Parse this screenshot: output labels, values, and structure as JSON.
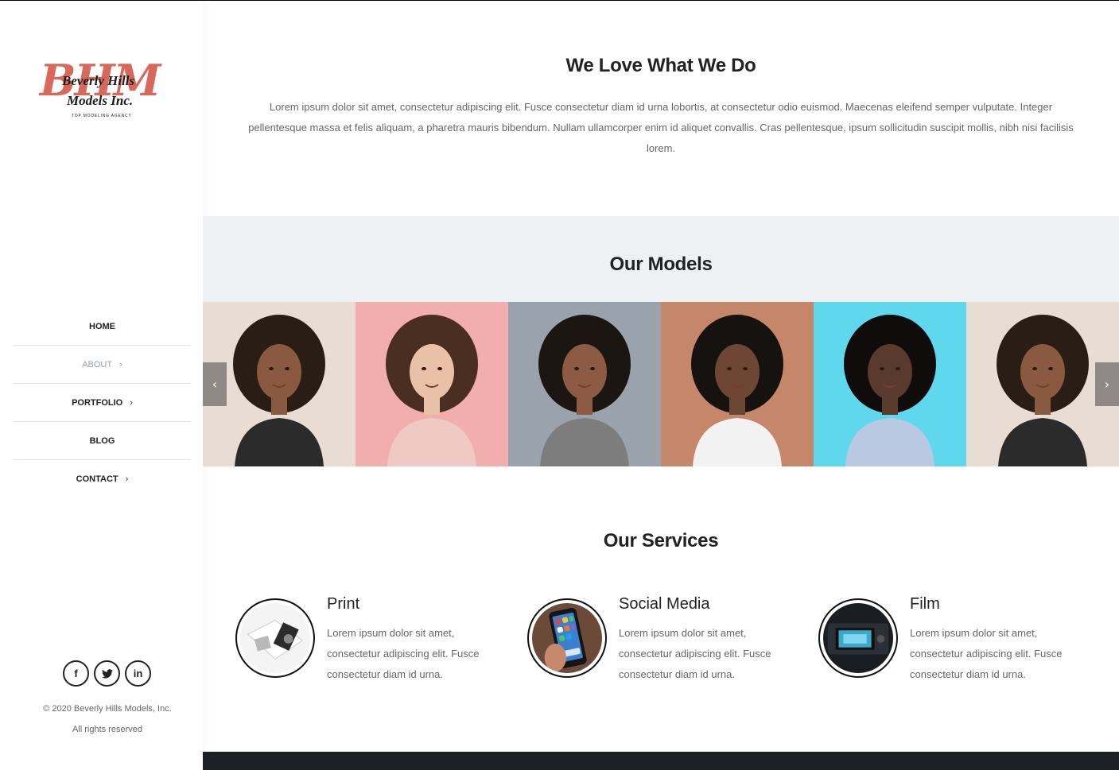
{
  "brand": {
    "logo_big": "BHM",
    "logo_line1": "Beverly Hills",
    "logo_line2": "Models Inc.",
    "tagline": "TOP MODELING AGENCY",
    "accent_color": "#d8695a"
  },
  "nav": {
    "items": [
      {
        "label": "HOME",
        "has_submenu": false,
        "active": false
      },
      {
        "label": "ABOUT",
        "has_submenu": true,
        "active": true
      },
      {
        "label": "PORTFOLIO",
        "has_submenu": true,
        "active": false
      },
      {
        "label": "BLOG",
        "has_submenu": false,
        "active": false
      },
      {
        "label": "CONTACT",
        "has_submenu": true,
        "active": false
      }
    ],
    "chevron": "›"
  },
  "social": {
    "facebook": "f",
    "twitter": "t",
    "linkedin": "in"
  },
  "footer": {
    "copyright": "© 2020 Beverly Hills Models, Inc.",
    "rights": "All rights reserved"
  },
  "intro": {
    "title": "We Love What We Do",
    "body": "Lorem ipsum dolor sit amet, consectetur adipiscing elit. Fusce consectetur diam id urna lobortis, at consectetur odio euismod. Maecenas eleifend semper vulputate. Integer pellentesque massa et felis aliquam, a pharetra mauris bibendum. Nullam ullamcorper enim id aliquet convallis. Cras pellentesque, ipsum sollicitudin suscipit mollis, nibh nisi facilisis lorem."
  },
  "models": {
    "title": "Our Models",
    "prev": "‹",
    "next": "›",
    "photos": [
      {
        "bg": "#e9dcd2",
        "hair": "#2a1d16",
        "skin": "#8a5a40",
        "top": "#2c2b2b"
      },
      {
        "bg": "#f2adad",
        "hair": "#4a2e22",
        "skin": "#e8c1a8",
        "top": "#efc9c4"
      },
      {
        "bg": "#9aa3ab",
        "hair": "#1c1612",
        "skin": "#8d5b43",
        "top": "#7d7d7d"
      },
      {
        "bg": "#c6866a",
        "hair": "#161210",
        "skin": "#6e4634",
        "top": "#f2f2f2"
      },
      {
        "bg": "#5fd8ee",
        "hair": "#0f0c0b",
        "skin": "#5a3a2d",
        "top": "#b9c9e2"
      },
      {
        "bg": "#e9dcd2",
        "hair": "#2a1d16",
        "skin": "#8a5a40",
        "top": "#2c2b2b"
      }
    ]
  },
  "services": {
    "title": "Our Services",
    "items": [
      {
        "name": "Print",
        "desc": "Lorem ipsum dolor sit amet, consectetur adipiscing elit. Fusce consectetur diam id urna.",
        "icon": "print-icon"
      },
      {
        "name": "Social Media",
        "desc": "Lorem ipsum dolor sit amet, consectetur adipiscing elit. Fusce consectetur diam id urna.",
        "icon": "social-media-icon"
      },
      {
        "name": "Film",
        "desc": "Lorem ipsum dolor sit amet, consectetur adipiscing elit. Fusce consectetur diam id urna.",
        "icon": "film-camera-icon"
      }
    ]
  }
}
